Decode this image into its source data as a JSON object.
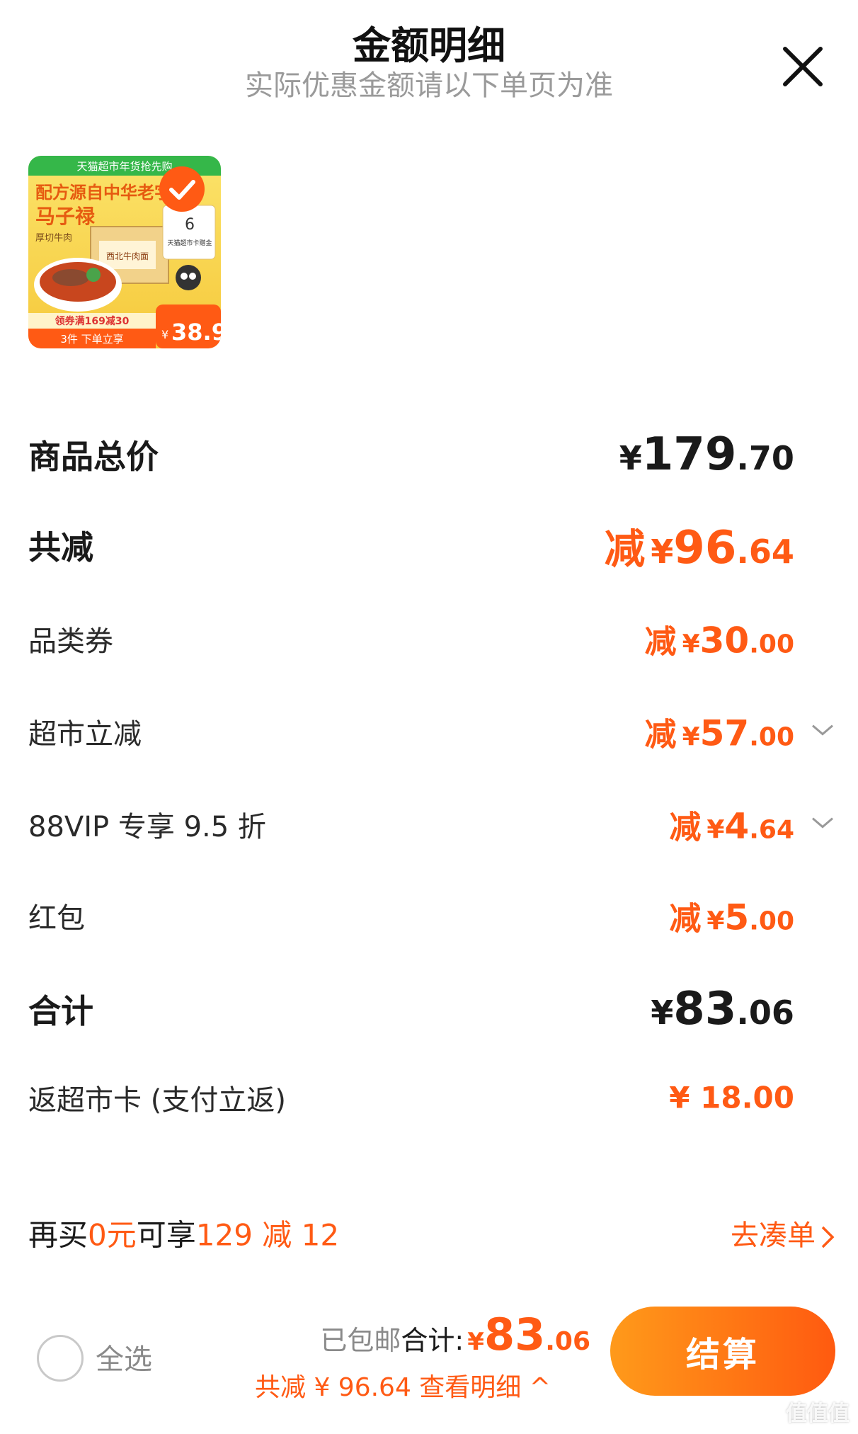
{
  "header": {
    "title": "金额明细",
    "subtitle": "实际优惠金额请以下单页为准"
  },
  "product": {
    "banner_text": "天猫超市年货抢先购",
    "headline": "配方源自中华老字号",
    "brand": "马子禄",
    "line1": "厚切牛肉",
    "box_text": "西北牛肉面",
    "card_text": "天猫超市卡赠金",
    "card_amount": "6",
    "coupon_text": "领券满169减30",
    "bottom_text": "3件 下单立享",
    "price": "38.9",
    "price_prefix": "¥",
    "selected": true
  },
  "summary": {
    "goods_total": {
      "label": "商品总价",
      "currency": "¥",
      "int": "179",
      "dec": ".70"
    },
    "total_discount": {
      "label": "共减",
      "prefix": "减",
      "currency": "¥",
      "int": "96",
      "dec": ".64"
    },
    "category_coupon": {
      "label": "品类券",
      "prefix": "减",
      "currency": "¥",
      "int": "30",
      "dec": ".00"
    },
    "supermarket_discount": {
      "label": "超市立减",
      "prefix": "减",
      "currency": "¥",
      "int": "57",
      "dec": ".00"
    },
    "vip_discount": {
      "label": "88VIP 专享 9.5 折",
      "prefix": "减",
      "currency": "¥",
      "int": "4",
      "dec": ".64"
    },
    "red_packet": {
      "label": "红包",
      "prefix": "减",
      "currency": "¥",
      "int": "5",
      "dec": ".00"
    },
    "total": {
      "label": "合计",
      "currency": "¥",
      "int": "83",
      "dec": ".06"
    },
    "card_rebate": {
      "label": "返超市卡 (支付立返)",
      "value": "¥ 18.00"
    }
  },
  "promo": {
    "text_a": "再买",
    "text_b": "0元",
    "text_c": "可享",
    "text_d": "129 减 12",
    "link": "去凑单"
  },
  "footer": {
    "select_all": "全选",
    "shipping": "已包邮",
    "total_label": "合计:",
    "currency": "¥",
    "int": "83",
    "dec": ".06",
    "saved": "共减 ¥ 96.64  查看明细 ^",
    "checkout": "结算"
  },
  "watermark": "值值值",
  "colors": {
    "accent": "#ff5a14",
    "checkout_start": "#ff9a1a",
    "checkout_end": "#ff5a10",
    "muted": "#9a9a9a"
  }
}
